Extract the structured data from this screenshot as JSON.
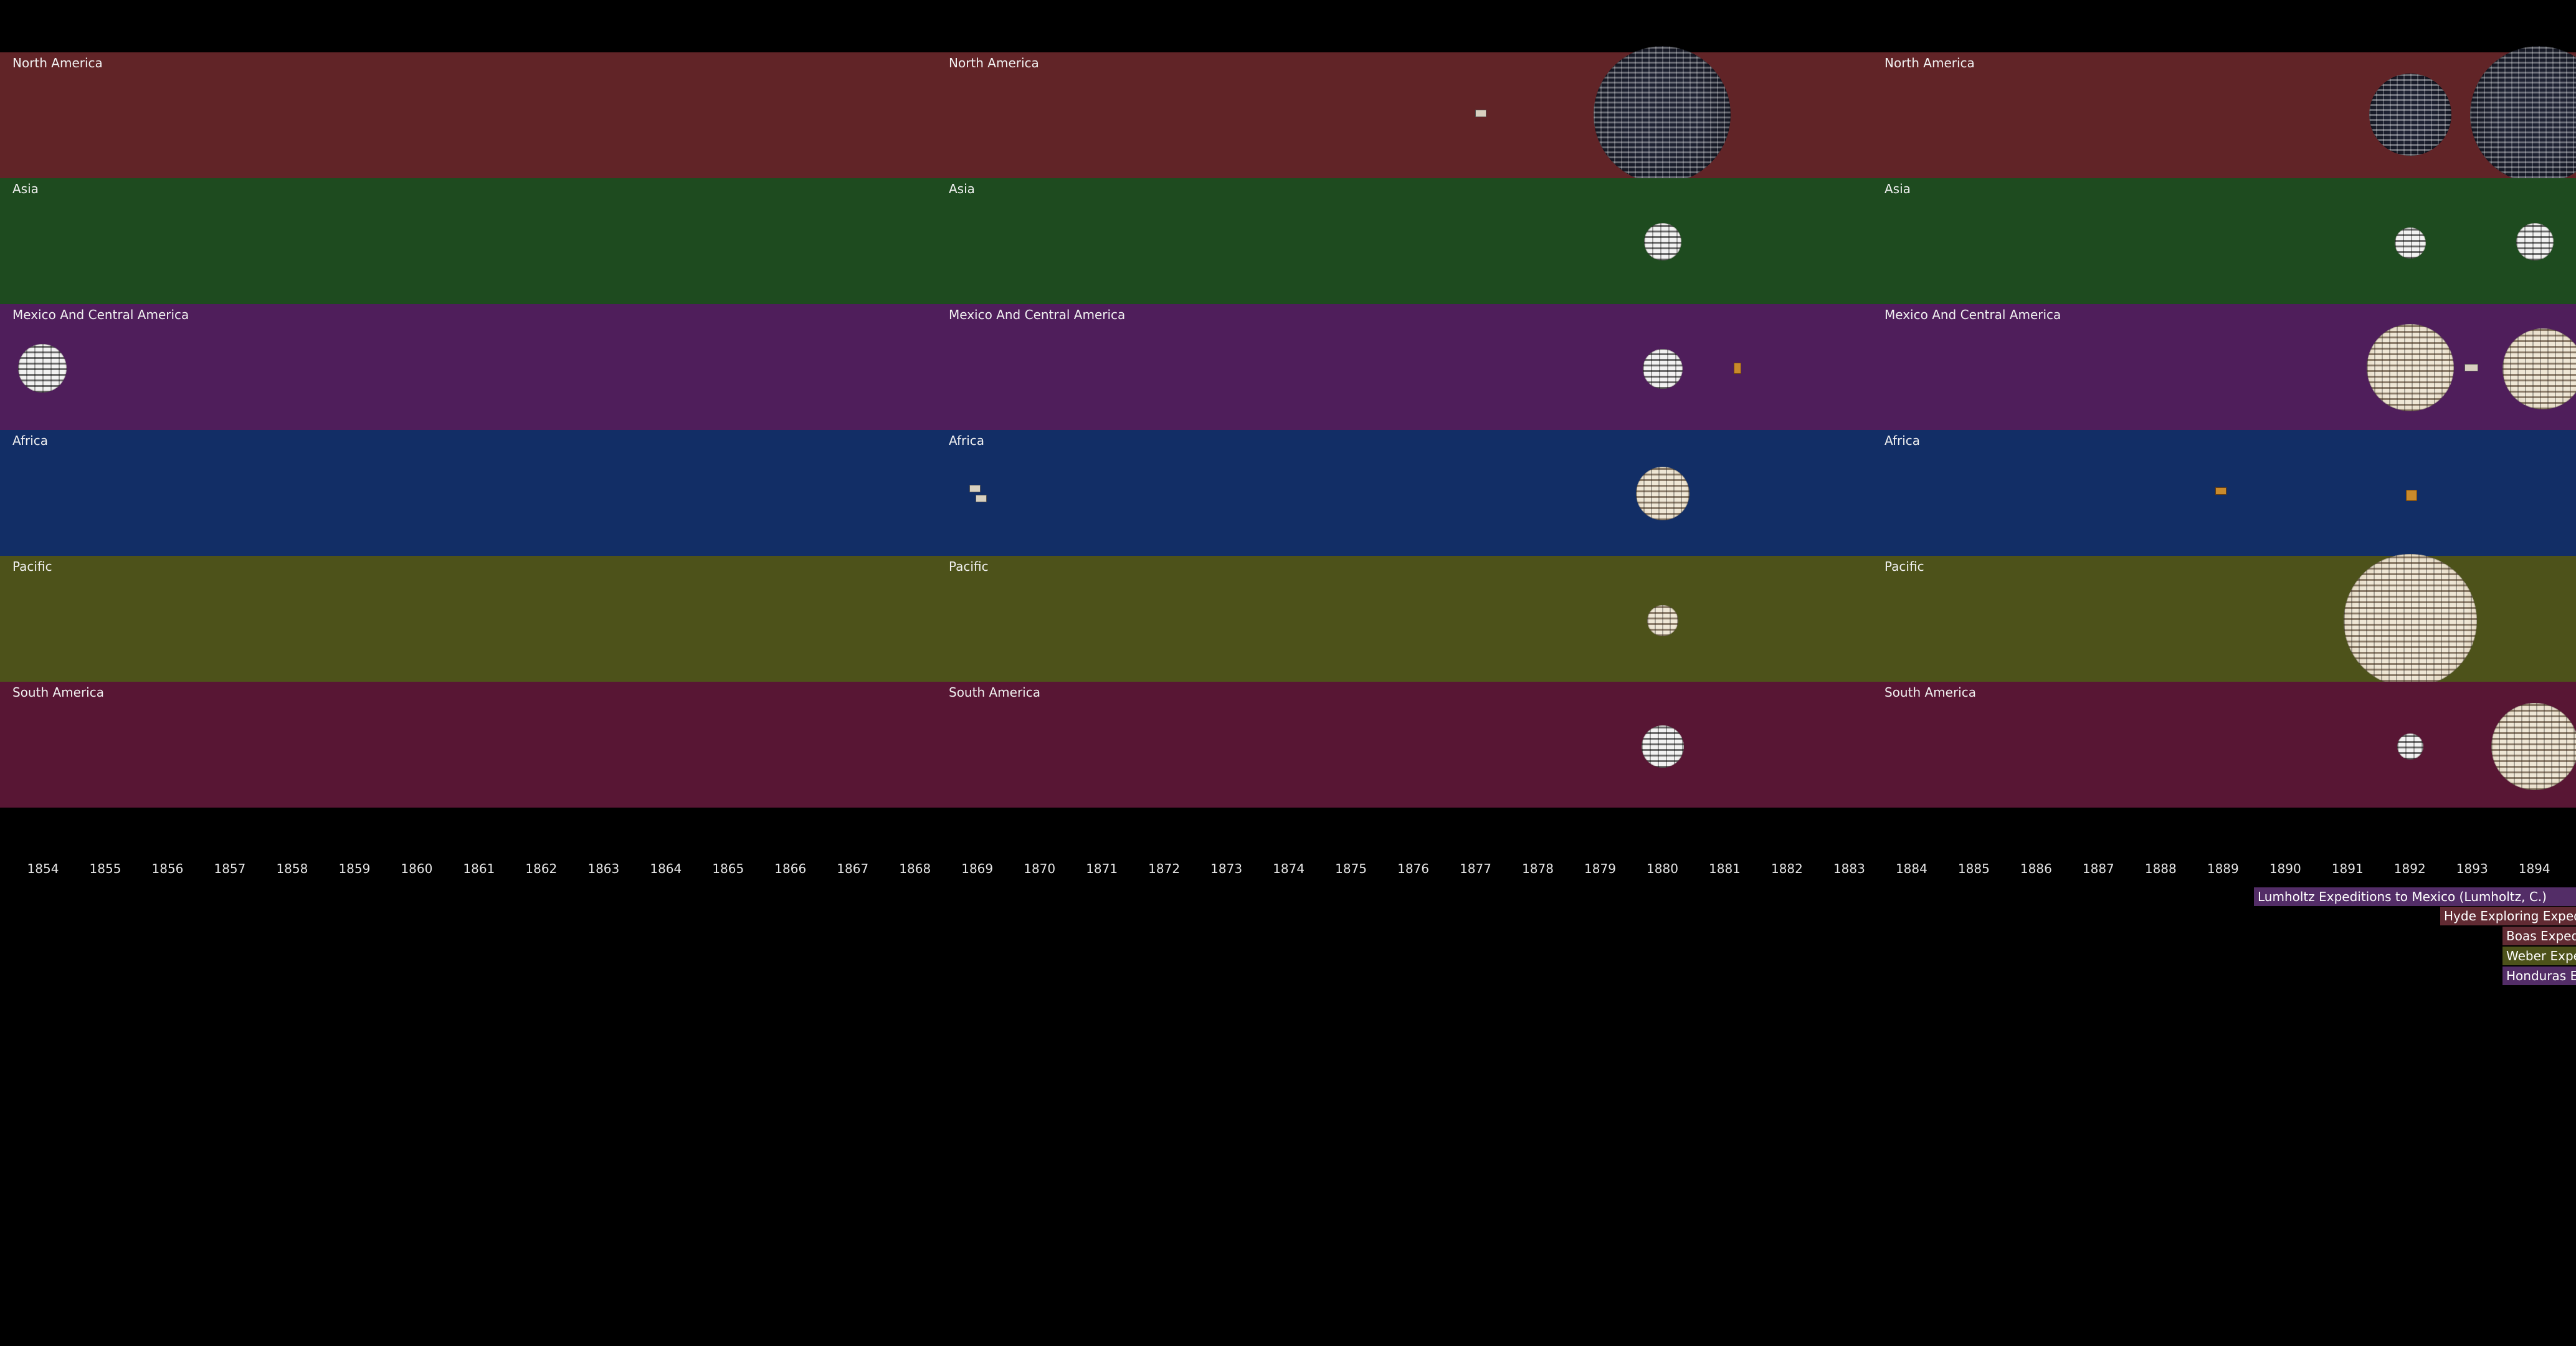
{
  "colors": {
    "background": "#000000",
    "band_north_america": "#612427",
    "band_asia": "#1e4b1f",
    "band_mexico": "#4f1e5b",
    "band_africa": "#122e66",
    "band_pacific": "#4d521a",
    "band_south_america": "#581634",
    "bar_lumholtz": "#532d67",
    "bar_hyde": "#612b33",
    "bar_boas": "#612b33",
    "bar_weber": "#4d521a",
    "bar_honduras": "#532d67"
  },
  "regions": [
    "North America",
    "Asia",
    "Mexico And Central America",
    "Africa",
    "Pacific",
    "South America"
  ],
  "years": [
    "1854",
    "1855",
    "1856",
    "1857",
    "1858",
    "1859",
    "1860",
    "1861",
    "1862",
    "1863",
    "1864",
    "1865",
    "1866",
    "1867",
    "1868",
    "1869",
    "1870",
    "1871",
    "1872",
    "1873",
    "1874",
    "1875",
    "1876",
    "1877",
    "1878",
    "1879",
    "1880",
    "1881",
    "1882",
    "1883",
    "1884",
    "1885",
    "1886",
    "1887",
    "1888",
    "1889",
    "1890",
    "1891",
    "1892",
    "1893",
    "1894"
  ],
  "expeditions": [
    {
      "label": "Lumholtz Expeditions to Mexico (Lumholtz, C.)",
      "color_key": "bar_lumholtz"
    },
    {
      "label": "Hyde Exploring Expedit",
      "color_key": "bar_hyde"
    },
    {
      "label": "Boas Expedi",
      "color_key": "bar_boas"
    },
    {
      "label": "Weber Expe",
      "color_key": "bar_weber"
    },
    {
      "label": "Honduras E",
      "color_key": "bar_honduras"
    }
  ]
}
